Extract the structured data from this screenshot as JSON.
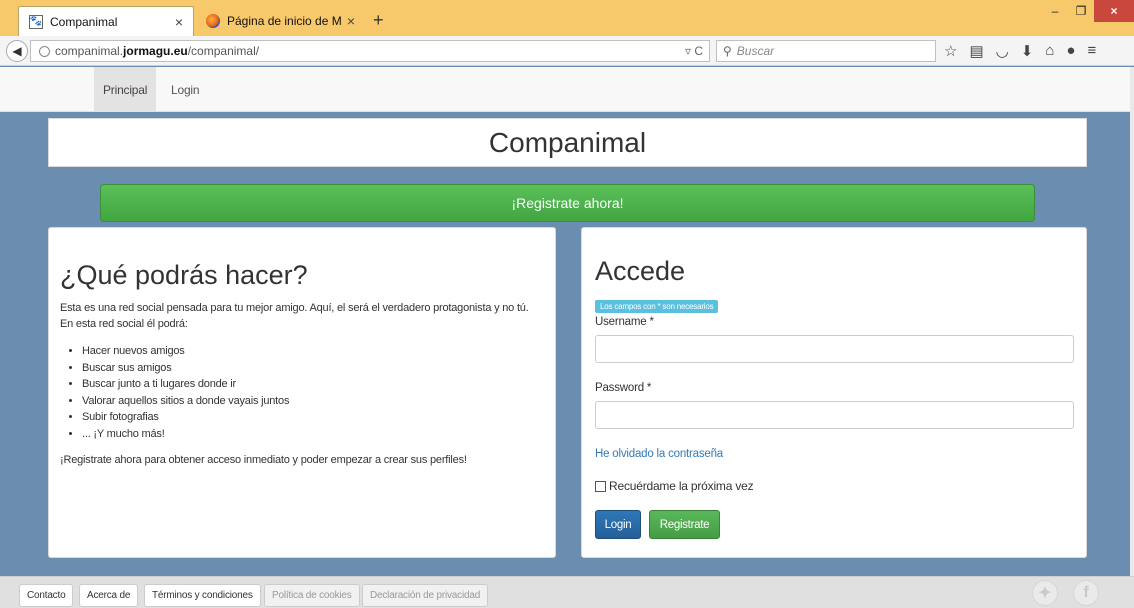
{
  "browser": {
    "tabs": [
      {
        "title": "Companimal",
        "close": "×"
      },
      {
        "title": "Página de inicio de Mozill...",
        "close": "×"
      }
    ],
    "new_tab": "+",
    "window_controls": {
      "minimize": "–",
      "maximize": "❐",
      "close": "×"
    },
    "url": {
      "prefix": "companimal.",
      "host_bold": "jormagu.eu",
      "path": "/companimal/"
    },
    "url_right": "▿ C",
    "search_placeholder": "Buscar",
    "toolbar_icons": [
      "star-icon",
      "reading-list-icon",
      "pocket-icon",
      "download-icon",
      "home-icon",
      "chat-icon",
      "menu-icon"
    ]
  },
  "sitenav": {
    "principal": "Principal",
    "login": "Login"
  },
  "header": {
    "title": "Companimal"
  },
  "register_banner": "¡Registrate ahora!",
  "left_panel": {
    "heading": "¿Qué podrás hacer?",
    "intro": "Esta es una red social pensada para tu mejor amigo. Aquí, el será el verdadero protagonista y no tú. En esta red social él podrá:",
    "items": [
      "Hacer nuevos amigos",
      "Buscar sus amigos",
      "Buscar junto a ti lugares donde ir",
      "Valorar aquellos sitios a donde vayais juntos",
      "Subir fotografias",
      "... ¡Y mucho más!"
    ],
    "outro": "¡Registrate ahora para obtener acceso inmediato y poder empezar a crear sus perfiles!"
  },
  "login_panel": {
    "heading": "Accede",
    "required_note": "Los campos con * son necesarios",
    "username_label": "Username *",
    "password_label": "Password *",
    "forgot_link": "He olvidado la contraseña",
    "remember_label": "Recuérdame la próxima vez",
    "login_button": "Login",
    "register_button": "Registrate"
  },
  "footer": {
    "buttons": [
      "Contacto",
      "Acerca de",
      "Términos y condiciones"
    ],
    "disabled_buttons": [
      "Política de cookies",
      "Declaración de privacidad"
    ],
    "social": [
      "twitter-icon",
      "facebook-icon"
    ]
  },
  "colors": {
    "page_bg": "#6b8db0",
    "register_green": "#4cae4c",
    "login_blue": "#286090",
    "link": "#337ab7",
    "info_badge": "#5bc0de"
  }
}
